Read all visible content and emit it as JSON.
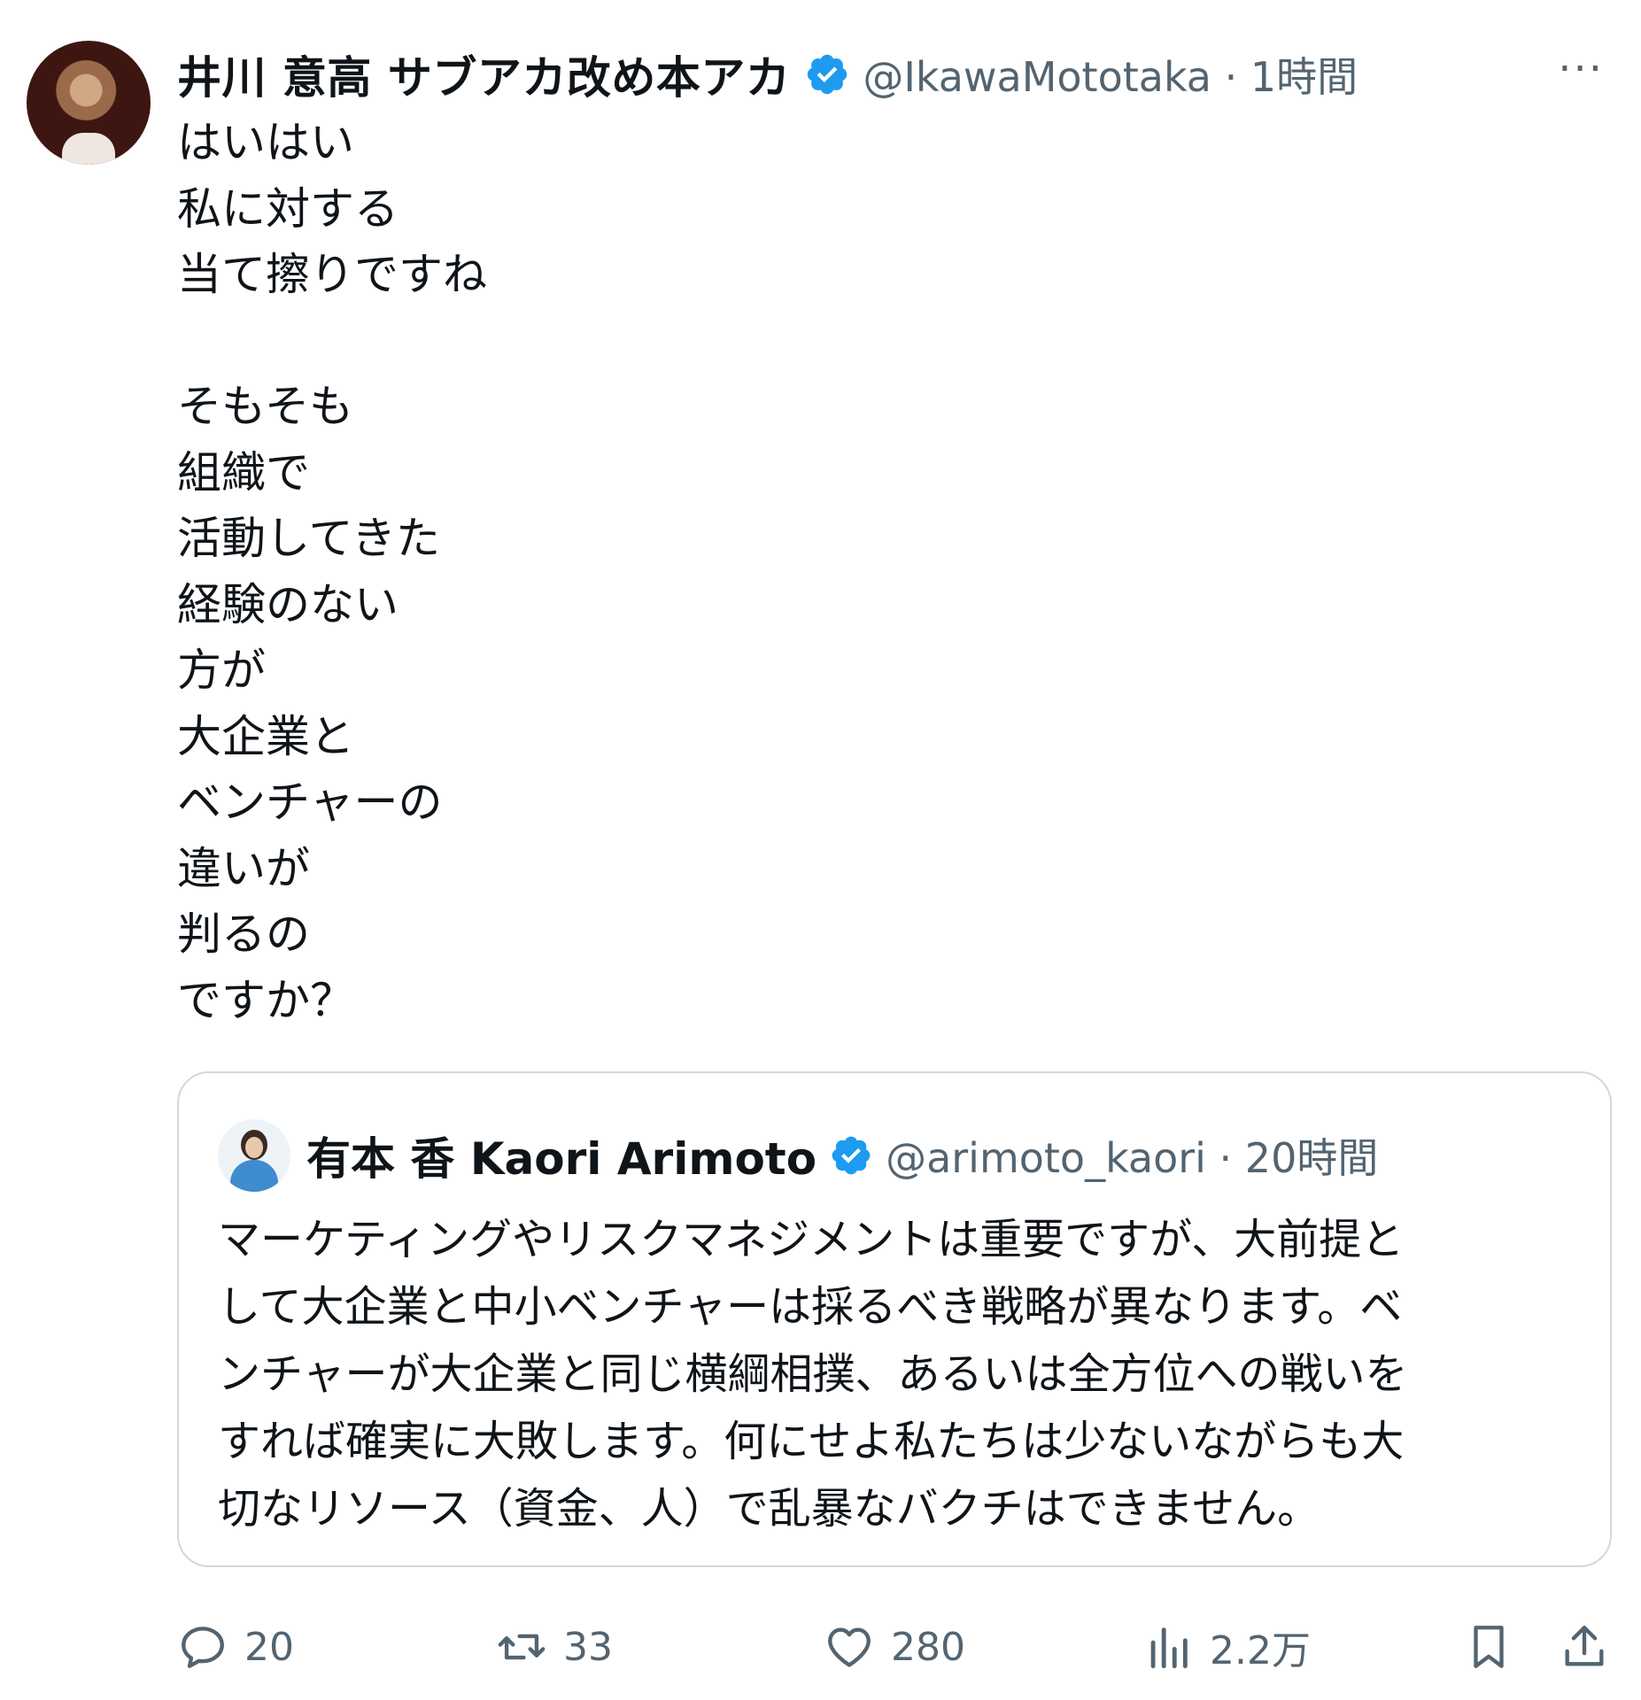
{
  "tweet": {
    "author": {
      "display_name": "井川 意高 サブアカ改め本アカ",
      "handle_meta": "@IkawaMototaka · 1時間"
    },
    "more_label": "···",
    "body_lines": [
      "はいはい",
      "私に対する",
      "当て擦りですね",
      "",
      "そもそも",
      "組織で",
      "活動してきた",
      "経験のない",
      "方が",
      "大企業と",
      "ベンチャーの",
      "違いが",
      "判るの",
      "ですか？"
    ],
    "quote": {
      "display_name": "有本 香 Kaori Arimoto",
      "handle_meta": "@arimoto_kaori · 20時間",
      "text_lines": [
        "マーケティングやリスクマネジメントは重要ですが、大前提と",
        "して大企業と中小ベンチャーは採るべき戦略が異なります。ベ",
        "ンチャーが大企業と同じ横綱相撲、あるいは全方位への戦いを",
        "すれば確実に大敗します。何にせよ私たちは少ないながらも大",
        "切なリソース（資金、人）で乱暴なバクチはできません。"
      ]
    },
    "actions": {
      "reply_count": "20",
      "retweet_count": "33",
      "like_count": "280",
      "views_count": "2.2万"
    }
  },
  "colors": {
    "text": "#0f1419",
    "secondary": "#536471",
    "verified": "#1d9bf0",
    "border": "#cfd9de"
  },
  "icons": [
    "verified-badge-icon",
    "more-icon",
    "reply-icon",
    "retweet-icon",
    "like-icon",
    "views-icon",
    "bookmark-icon",
    "share-icon"
  ]
}
